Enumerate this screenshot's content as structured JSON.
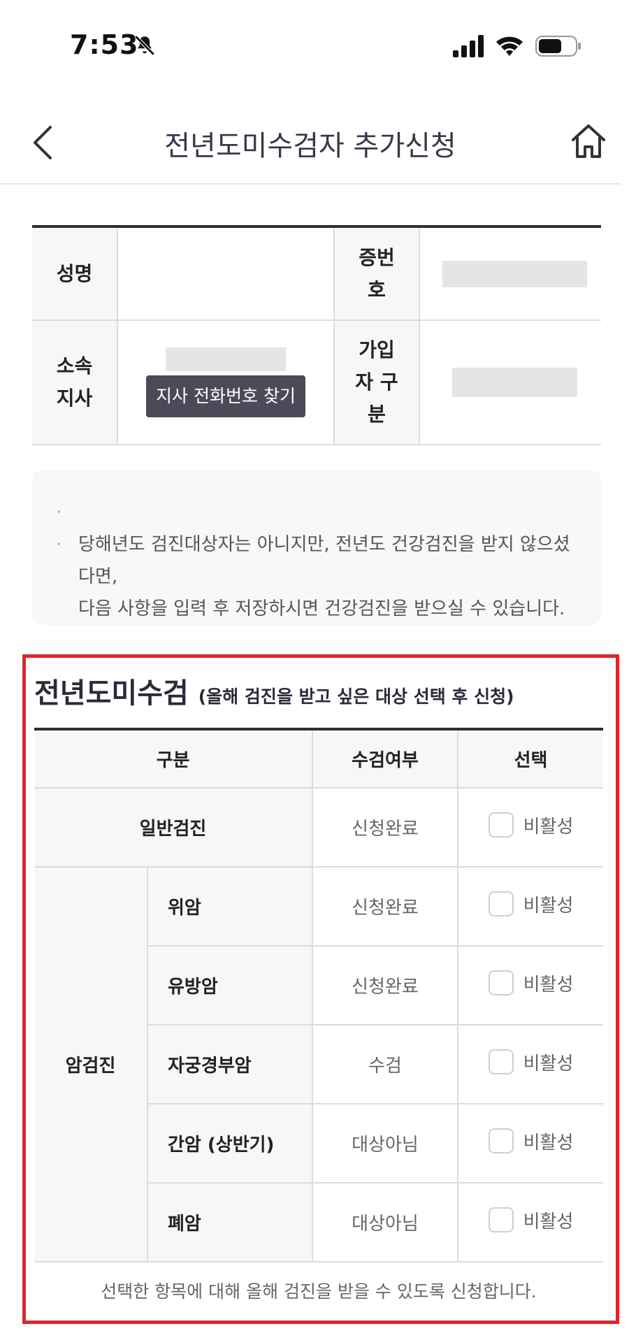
{
  "status_bar": {
    "time": "7:53"
  },
  "header": {
    "title": "전년도미수검자 추가신청"
  },
  "info": {
    "name_label": "성명",
    "id_label_line1": "증번",
    "id_label_line2": "호",
    "branch_label_line1": "소속",
    "branch_label_line2": "지사",
    "branch_button": "지사 전화번호 찾기",
    "member_type_label_line1": "가입",
    "member_type_label_line2": "자 구",
    "member_type_label_line3": "분"
  },
  "notice": {
    "line1": "당해년도 검진대상자는 아니지만, 전년도 건강검진을 받지 않으셨다면,",
    "line2": "다음 사항을 입력 후 저장하시면 건강검진을 받으실 수 있습니다."
  },
  "section": {
    "title": "전년도미수검",
    "subtitle": "(올해 검진을 받고 싶은 대상 선택 후 신청)",
    "columns": [
      "구분",
      "수검여부",
      "선택"
    ],
    "general": {
      "label": "일반검진",
      "status": "신청완료",
      "option": "비활성"
    },
    "cancel_group_label": "암검진",
    "cancer_rows": [
      {
        "label": "위암",
        "status": "신청완료",
        "option": "비활성"
      },
      {
        "label": "유방암",
        "status": "신청완료",
        "option": "비활성"
      },
      {
        "label": "자궁경부암",
        "status": "수검",
        "option": "비활성"
      },
      {
        "label": "간암 (상반기)",
        "status": "대상아님",
        "option": "비활성"
      },
      {
        "label": "폐암",
        "status": "대상아님",
        "option": "비활성"
      }
    ],
    "footer_note": "선택한 항목에 대해 올해 검진을 받을 수 있도록 신청합니다."
  }
}
